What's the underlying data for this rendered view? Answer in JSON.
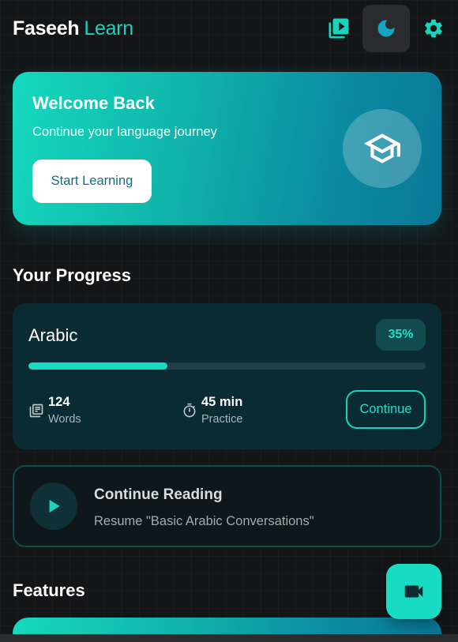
{
  "header": {
    "brand_primary": "Faseeh",
    "brand_secondary": "Learn",
    "icons": {
      "video": "video-library-icon",
      "theme": "moon-icon",
      "settings": "gear-icon"
    }
  },
  "hero": {
    "title": "Welcome Back",
    "subtitle": "Continue your language journey",
    "button_label": "Start Learning",
    "icon": "graduation-cap-icon"
  },
  "progress": {
    "section_title": "Your Progress",
    "language": "Arabic",
    "percent_label": "35%",
    "percent_value": 35,
    "stats": [
      {
        "value": "124",
        "label": "Words",
        "icon": "document-list-icon"
      },
      {
        "value": "45 min",
        "label": "Practice",
        "icon": "stopwatch-icon"
      }
    ],
    "continue_label": "Continue"
  },
  "reading": {
    "title": "Continue Reading",
    "subtitle": "Resume \"Basic Arabic Conversations\"",
    "icon": "play-icon"
  },
  "features": {
    "section_title": "Features"
  },
  "fab": {
    "icon": "video-camera-icon"
  },
  "colors": {
    "accent": "#19d3bd",
    "background": "#141517",
    "card": "#0b2b32",
    "hero_start": "#15d9be",
    "hero_end": "#097898"
  }
}
